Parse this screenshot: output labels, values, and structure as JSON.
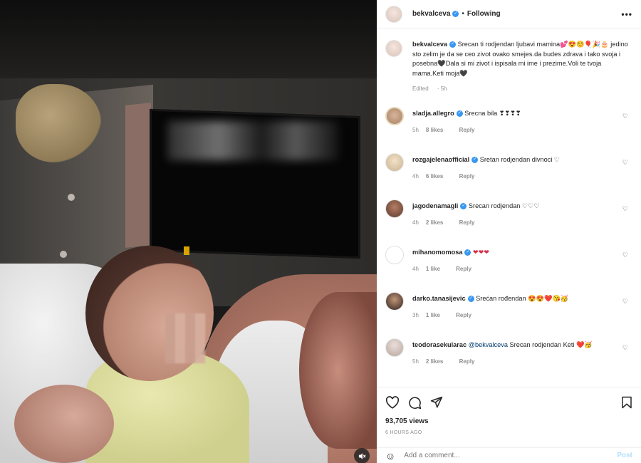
{
  "post": {
    "username": "bekvalceva",
    "verified": true,
    "follow_state": "Following",
    "more_icon": "more-horizontal-icon",
    "media_mute_icon": "speaker-muted-icon"
  },
  "caption": {
    "username": "bekvalceva",
    "text": "Srecan ti rodjendan ljubavi mamina💕😍☺️🎈🎉🎂 jedino sto zelim je da se ceo zivot ovako smejes.da budes zdrava i tako svoja i posebna🖤Dala si mi zivot i ispisala mi ime i prezime.Voli te tvoja mama.Keti moja🖤",
    "edited": "Edited",
    "time": "5h"
  },
  "comments": [
    {
      "username": "sladja.allegro",
      "text": "Srecna bila ❣❣❣❣",
      "time": "5h",
      "likes": "8 likes",
      "reply": "Reply"
    },
    {
      "username": "rozgajelenaofficial",
      "text": "Sretan rodjendan divnoci ♡",
      "time": "4h",
      "likes": "6 likes",
      "reply": "Reply"
    },
    {
      "username": "jagodenamagli",
      "text": "Srecan rodjendan ♡♡♡",
      "time": "4h",
      "likes": "2 likes",
      "reply": "Reply"
    },
    {
      "username": "mihanomomosa",
      "text": "❤❤❤",
      "time": "4h",
      "likes": "1 like",
      "reply": "Reply"
    },
    {
      "username": "darko.tanasijevic",
      "text": "Srećan rođendan 😍😍❤️😘🥳",
      "time": "3h",
      "likes": "1 like",
      "reply": "Reply"
    },
    {
      "username": "teodorasekularac",
      "mention": "@bekvalceva",
      "text": "Srecan rodjendan Keti ❤️🥳",
      "time": "5h",
      "likes": "2 likes",
      "reply": "Reply"
    }
  ],
  "actions": {
    "views": "93,705 views",
    "ago": "6 HOURS AGO",
    "comment_placeholder": "Add a comment...",
    "post_label": "Post"
  },
  "colors": {
    "verified_blue": "#3897f0",
    "meta_gray": "#8e8e8e",
    "post_disabled": "#b2dffc"
  }
}
